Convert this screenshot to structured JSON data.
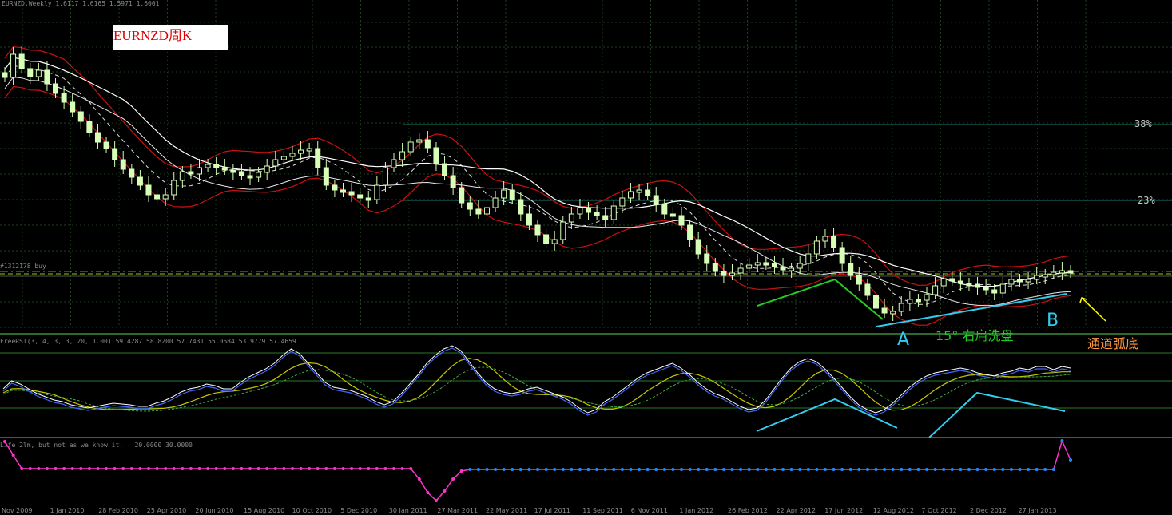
{
  "header": {
    "main_title": "EURNZD,Weekly  1.6117 1.6165 1.5971 1.6001",
    "osc_title": "FreeRSI(3, 4, 3, 3, 20, 1.00) 59.4287 58.8200 57.7431 55.0684 53.9779 57.4659",
    "osc2_title": "Life 2lm, but not as we know it... 20.0000 30.0000",
    "price_label": "#1312178 buy"
  },
  "title_box": "EURNZD周K",
  "annotations": {
    "label_a": "A",
    "label_b": "B",
    "shoulder": "15° 右肩洗盘",
    "arc_bottom": "通道弧底",
    "fib_38": "38%",
    "fib_23": "23%"
  },
  "colors": {
    "background": "#000000",
    "grid": "#1f4a1f",
    "candle_up": "#000000",
    "candle_down": "#d8ffb8",
    "ma_fast": "#ffffff",
    "band": "#cc1111",
    "mid_dash": "#ffffff",
    "fib_line": "#1a7a6a",
    "osc_blue": "#4466ff",
    "osc_yellow": "#c8c800",
    "step_magenta": "#ff33cc",
    "step_blue": "#2288ff",
    "annot_green": "#22cc22",
    "annot_cyan": "#33ccee",
    "annot_yellow": "#ffff00",
    "annot_orange": "#ff9944"
  },
  "chart_data": {
    "type": "candlestick",
    "title": "EURNZD周K",
    "x_ticks": [
      "Nov 2009",
      "1 Jan 2010",
      "28 Feb 2010",
      "25 Apr 2010",
      "20 Jun 2010",
      "15 Aug 2010",
      "10 Oct 2010",
      "5 Dec 2010",
      "30 Jan 2011",
      "27 Mar 2011",
      "22 May 2011",
      "17 Jul 2011",
      "11 Sep 2011",
      "6 Nov 2011",
      "1 Jan 2012",
      "26 Feb 2012",
      "22 Apr 2012",
      "17 Jun 2012",
      "12 Aug 2012",
      "7 Oct 2012",
      "2 Dec 2012",
      "27 Jan 2013"
    ],
    "fib_levels": [
      "38%",
      "23%"
    ],
    "close_path": [
      97,
      68,
      86,
      96,
      88,
      105,
      117,
      128,
      140,
      152,
      166,
      178,
      186,
      200,
      212,
      222,
      232,
      244,
      249,
      244,
      226,
      215,
      218,
      210,
      206,
      210,
      213,
      215,
      220,
      222,
      216,
      208,
      200,
      196,
      192,
      188,
      186,
      210,
      232,
      238,
      240,
      244,
      248,
      250,
      232,
      210,
      200,
      190,
      178,
      175,
      185,
      205,
      220,
      235,
      254,
      262,
      268,
      260,
      248,
      238,
      250,
      268,
      282,
      294,
      305,
      300,
      278,
      268,
      260,
      266,
      270,
      275,
      258,
      248,
      240,
      238,
      245,
      256,
      268,
      270,
      282,
      300,
      318,
      330,
      340,
      345,
      342,
      336,
      332,
      329,
      330,
      334,
      338,
      336,
      330,
      318,
      302,
      296,
      310,
      330,
      345,
      356,
      370,
      386,
      392,
      390,
      380,
      375,
      376,
      369,
      358,
      349,
      352,
      355,
      356,
      360,
      363,
      367,
      356,
      350,
      351,
      350,
      345,
      344,
      341,
      339,
      340
    ],
    "osc_path": [
      490,
      480,
      484,
      490,
      496,
      500,
      504,
      506,
      510,
      512,
      514,
      512,
      510,
      508,
      509,
      510,
      512,
      512,
      508,
      505,
      500,
      494,
      490,
      488,
      484,
      486,
      490,
      490,
      482,
      475,
      470,
      465,
      458,
      448,
      440,
      446,
      458,
      470,
      482,
      488,
      490,
      492,
      496,
      500,
      506,
      510,
      506,
      496,
      484,
      472,
      458,
      448,
      440,
      436,
      442,
      456,
      470,
      482,
      490,
      494,
      496,
      494,
      490,
      488,
      492,
      496,
      500,
      506,
      514,
      520,
      516,
      506,
      500,
      492,
      484,
      476,
      470,
      466,
      462,
      458,
      464,
      472,
      482,
      490,
      496,
      500,
      506,
      512,
      516,
      514,
      504,
      490,
      476,
      464,
      456,
      452,
      456,
      465,
      476,
      488,
      500,
      510,
      516,
      520,
      516,
      508,
      498,
      488,
      480,
      474,
      470,
      468,
      466,
      464,
      466,
      470,
      472,
      474,
      470,
      468,
      464,
      466,
      462,
      462,
      466,
      462,
      464
    ],
    "step_path": [
      553,
      570,
      587,
      587,
      587,
      587,
      587,
      587,
      587,
      587,
      587,
      587,
      587,
      587,
      587,
      587,
      587,
      587,
      587,
      587,
      587,
      587,
      587,
      587,
      587,
      587,
      587,
      587,
      587,
      587,
      587,
      587,
      587,
      587,
      587,
      587,
      587,
      587,
      587,
      587,
      587,
      587,
      587,
      587,
      587,
      587,
      587,
      587,
      587,
      600,
      617,
      627,
      615,
      600,
      590,
      588,
      588,
      588,
      588,
      588,
      588,
      588,
      588,
      588,
      588,
      588,
      588,
      588,
      588,
      588,
      588,
      588,
      588,
      588,
      588,
      588,
      588,
      588,
      588,
      588,
      588,
      588,
      588,
      588,
      588,
      588,
      588,
      588,
      588,
      588,
      588,
      588,
      588,
      588,
      588,
      588,
      588,
      588,
      588,
      588,
      588,
      588,
      588,
      588,
      588,
      588,
      588,
      588,
      588,
      588,
      588,
      588,
      588,
      588,
      588,
      588,
      588,
      588,
      588,
      588,
      588,
      588,
      588,
      588,
      588,
      552,
      576
    ]
  }
}
